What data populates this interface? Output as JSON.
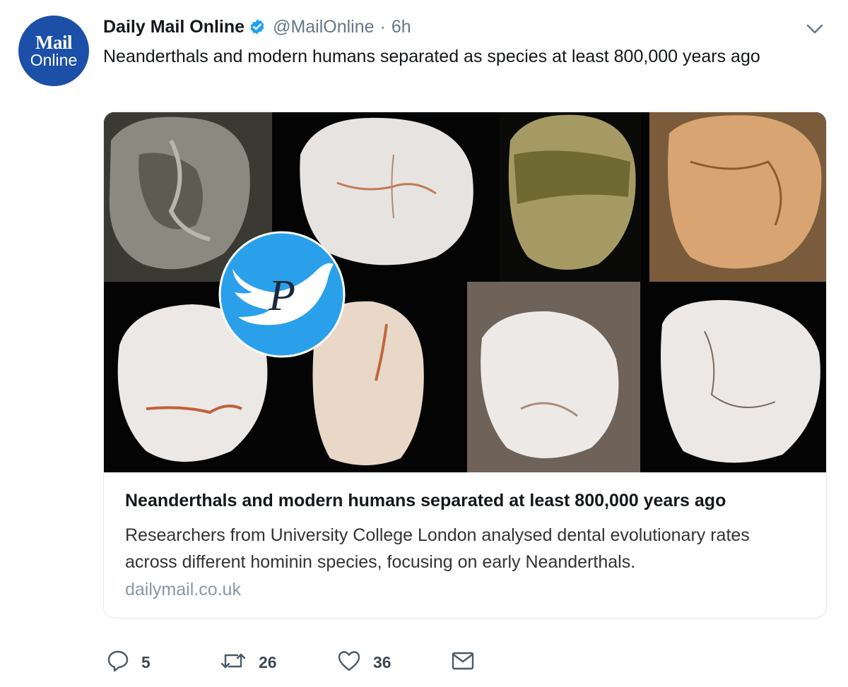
{
  "account": {
    "avatar_line1": "Mail",
    "avatar_line2": "Online",
    "name": "Daily Mail Online",
    "verified": true,
    "handle": "@MailOnline",
    "separator": "·",
    "time": "6h"
  },
  "tweet": {
    "text": "Neanderthals and modern humans separated as species at least 800,000 years ago"
  },
  "card": {
    "title": "Neanderthals and modern humans separated at least 800,000 years ago",
    "description": "Researchers from University College London analysed dental evolutionary rates across different hominin species, focusing on early Neanderthals.",
    "domain": "dailymail.co.uk",
    "watermark_letter": "P"
  },
  "actions": {
    "replies": "5",
    "retweets": "26",
    "likes": "36"
  },
  "icons": {
    "verified": "verified-badge-icon",
    "caret": "chevron-down-icon",
    "reply": "reply-icon",
    "retweet": "retweet-icon",
    "like": "heart-icon",
    "dm": "envelope-icon"
  },
  "colors": {
    "verified_blue": "#1da1f2",
    "avatar_blue": "#1b4fa8",
    "secondary_text": "#657786",
    "domain_text": "#8899a6"
  }
}
